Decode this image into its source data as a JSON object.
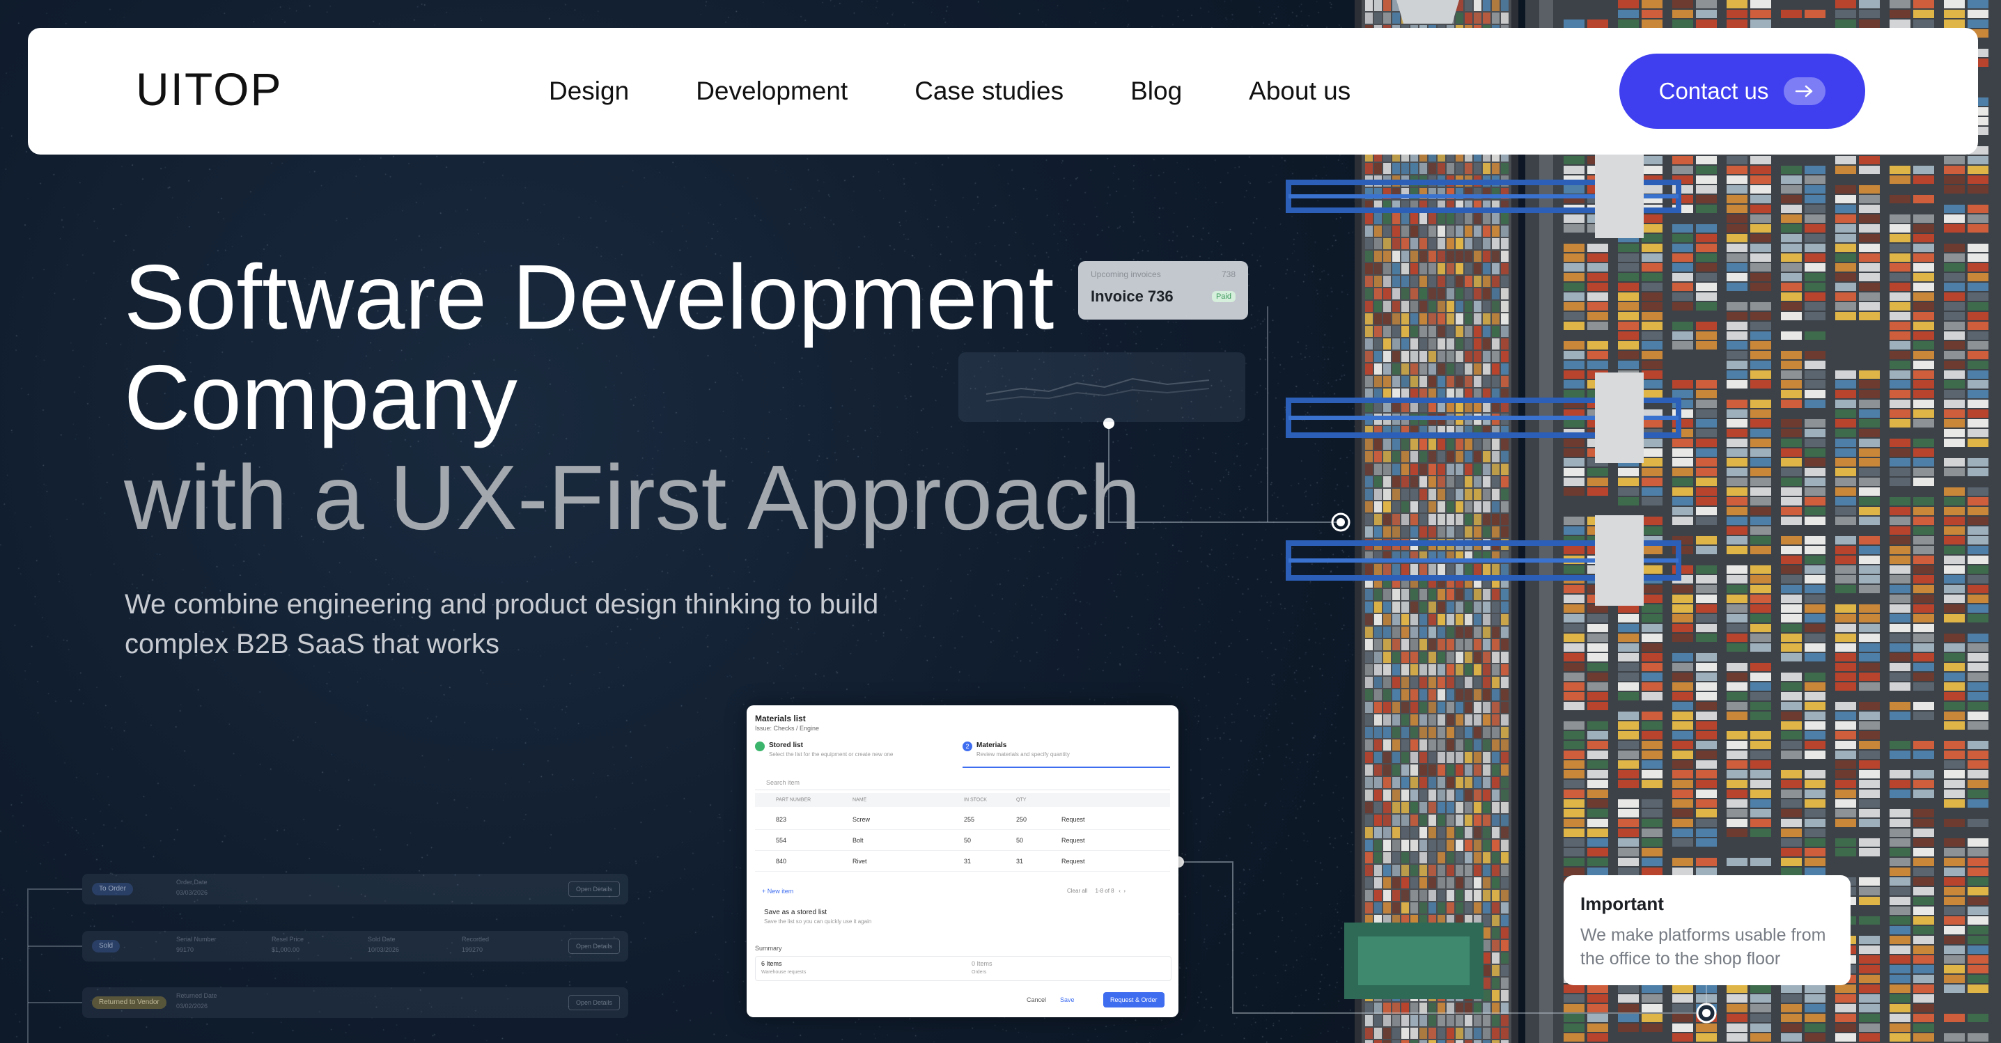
{
  "header": {
    "logo": "UITOP",
    "nav": [
      "Design",
      "Development",
      "Case studies",
      "Blog",
      "About us"
    ],
    "contact_label": "Contact us",
    "contact_icon": "arrow-right-icon"
  },
  "hero": {
    "title_line1": "Software Development",
    "title_line2": "Company",
    "title_line3": "with a UX-First Approach",
    "subtitle_line1": "We combine engineering and product design thinking to build",
    "subtitle_line2": "complex B2B SaaS that works"
  },
  "invoice_card": {
    "label": "Upcoming invoices",
    "count": "738",
    "title": "Invoice 736",
    "status": "Paid"
  },
  "materials_panel": {
    "title": "Materials list",
    "breadcrumb": "Issue: Checks / Engine",
    "step1_title": "Stored list",
    "step1_sub": "Select the list for the equipment or create new one",
    "step2_num": "2",
    "step2_title": "Materials",
    "step2_sub": "Review materials and specify quantity",
    "search_placeholder": "Search item",
    "columns": [
      "PART NUMBER",
      "NAME",
      "IN STOCK",
      "QTY"
    ],
    "rows": [
      {
        "part": "823",
        "name": "Screw",
        "stock": "255",
        "qty": "250",
        "action": "Request"
      },
      {
        "part": "554",
        "name": "Bolt",
        "stock": "50",
        "qty": "50",
        "action": "Request"
      },
      {
        "part": "840",
        "name": "Rivet",
        "stock": "31",
        "qty": "31",
        "action": "Request"
      }
    ],
    "new_item": "+ New item",
    "clear_all": "Clear all",
    "pager": "1-8 of 8",
    "save_title": "Save as a stored list",
    "save_sub": "Save the list so you can quickly use it again",
    "summary_label": "Summary",
    "summary_items": "6 Items",
    "summary_items_sub": "Warehouse requests",
    "summary_orders": "0 Items",
    "summary_orders_sub": "Orders",
    "cancel": "Cancel",
    "save": "Save",
    "request_order": "Request & Order"
  },
  "ghost_rows": [
    {
      "badge": "To Order",
      "badge_color": "#3b5a9a",
      "f1_label": "Order Date",
      "f1_value": "03/03/2026",
      "f2_label": "",
      "f2_value": "",
      "f3_label": "",
      "f3_value": "",
      "f4_label": "",
      "f4_value": "",
      "btn": "Open Details"
    },
    {
      "badge": "Sold",
      "badge_color": "#3b5a9a",
      "f1_label": "Serial Number",
      "f1_value": "99170",
      "f2_label": "Resel Price",
      "f2_value": "$1,000.00",
      "f3_label": "Sold Date",
      "f3_value": "10/03/2026",
      "f4_label": "Recorded",
      "f4_value": "199270",
      "btn": "Open Details"
    },
    {
      "badge": "Returned to Vendor",
      "badge_color": "#8a7a3a",
      "f1_label": "Returned Date",
      "f1_value": "03/02/2026",
      "f2_label": "",
      "f2_value": "",
      "f3_label": "",
      "f3_value": "",
      "f4_label": "",
      "f4_value": "",
      "btn": "Open Details"
    }
  ],
  "important_card": {
    "title": "Important",
    "text_line1": "We make platforms usable from",
    "text_line2": "the office to the shop floor"
  },
  "colors": {
    "accent": "#3f3ff0",
    "sea": "#0c1726",
    "port_ground": "#4a4f55"
  }
}
